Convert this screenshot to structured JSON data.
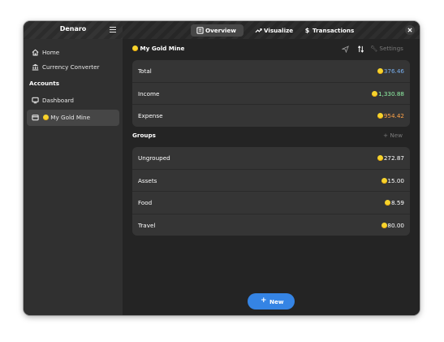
{
  "app": {
    "title": "Denaro"
  },
  "sidebar": {
    "items": [
      {
        "label": "Home",
        "icon": "home-icon"
      },
      {
        "label": "Currency Converter",
        "icon": "bank-icon"
      }
    ],
    "accounts_section_label": "Accounts",
    "account_items": [
      {
        "label": "Dashboard",
        "icon": "monitor-icon"
      },
      {
        "label": "My Gold Mine",
        "icon": "wallet-icon",
        "active": true
      }
    ]
  },
  "header": {
    "tabs": [
      {
        "label": "Overview",
        "icon": "overview-icon",
        "active": true
      },
      {
        "label": "Visualize",
        "icon": "trend-icon"
      },
      {
        "label": "Transactions",
        "icon": "dollar-icon"
      }
    ]
  },
  "account": {
    "title": "My Gold Mine",
    "settings_label": "Settings"
  },
  "summary": {
    "rows": [
      {
        "label": "Total",
        "value": "376.46",
        "color": "#78aeed"
      },
      {
        "label": "Income",
        "value": "1,330.88",
        "color": "#8ff0a4"
      },
      {
        "label": "Expense",
        "value": "954.42",
        "color": "#ffa348"
      }
    ]
  },
  "groups": {
    "title": "Groups",
    "new_label": "New",
    "rows": [
      {
        "label": "Ungrouped",
        "value": "272.87"
      },
      {
        "label": "Assets",
        "value": "15.00"
      },
      {
        "label": "Food",
        "value": "8.59"
      },
      {
        "label": "Travel",
        "value": "80.00"
      }
    ]
  },
  "fab": {
    "label": "New"
  },
  "colors": {
    "accent": "#3584e4",
    "coin": "#f6d32d"
  }
}
